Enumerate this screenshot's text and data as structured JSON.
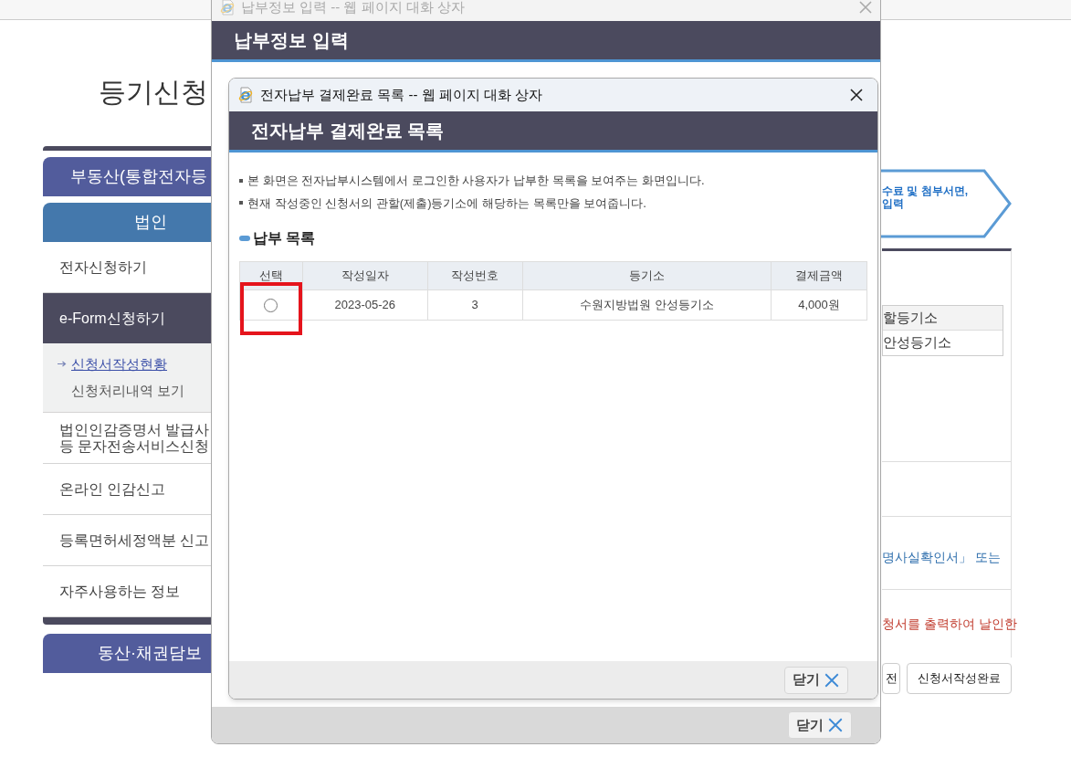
{
  "page": {
    "title": "등기신청",
    "sidebar": {
      "category": "부동산(통합전자등",
      "tab": "법인",
      "items": [
        {
          "label": "전자신청하기",
          "selected": false
        },
        {
          "label": "e-Form신청하기",
          "selected": true,
          "children": [
            {
              "label": "신청서작성현황",
              "selected": true
            },
            {
              "label": "신청처리내역 보기",
              "selected": false
            }
          ]
        },
        {
          "label": "법인인감증명서 발급사\n등 문자전송서비스신청",
          "selected": false
        },
        {
          "label": "온라인 인감신고",
          "selected": false
        },
        {
          "label": "등록면허세정액분 신고",
          "selected": false
        },
        {
          "label": "자주사용하는 정보",
          "selected": false
        }
      ],
      "bottom_category": "동산·채권담보"
    },
    "step": {
      "lines": [
        "수료 및 첨부서면,",
        "입력"
      ]
    },
    "court_table": {
      "header": "할등기소",
      "cell": "안성등기소"
    },
    "notice_blue": "명사실확인서」 또는",
    "notice_red": "청서를 출력하여 날인한",
    "buttons": [
      "전",
      "신청서작성완료"
    ]
  },
  "outer_dialog": {
    "title": "납부정보 입력 -- 웹 페이지 대화 상자",
    "heading": "납부정보 입력",
    "close_label": "닫기"
  },
  "inner_dialog": {
    "title": "전자납부 결제완료 목록 -- 웹 페이지 대화 상자",
    "heading": "전자납부 결제완료 목록",
    "notes": [
      "본 화면은 전자납부시스템에서 로그인한 사용자가 납부한 목록을 보여주는 화면입니다.",
      "현재 작성중인 신청서의 관할(제출)등기소에 해당하는 목록만을 보여줍니다."
    ],
    "section_title": "납부 목록",
    "table": {
      "columns": [
        "선택",
        "작성일자",
        "작성번호",
        "등기소",
        "결제금액"
      ],
      "rows": [
        {
          "selected": false,
          "highlighted": true,
          "cells": [
            "",
            "2023-05-26",
            "3",
            "수원지방법원 안성등기소",
            "4,000원"
          ]
        }
      ]
    },
    "close_label": "닫기"
  }
}
